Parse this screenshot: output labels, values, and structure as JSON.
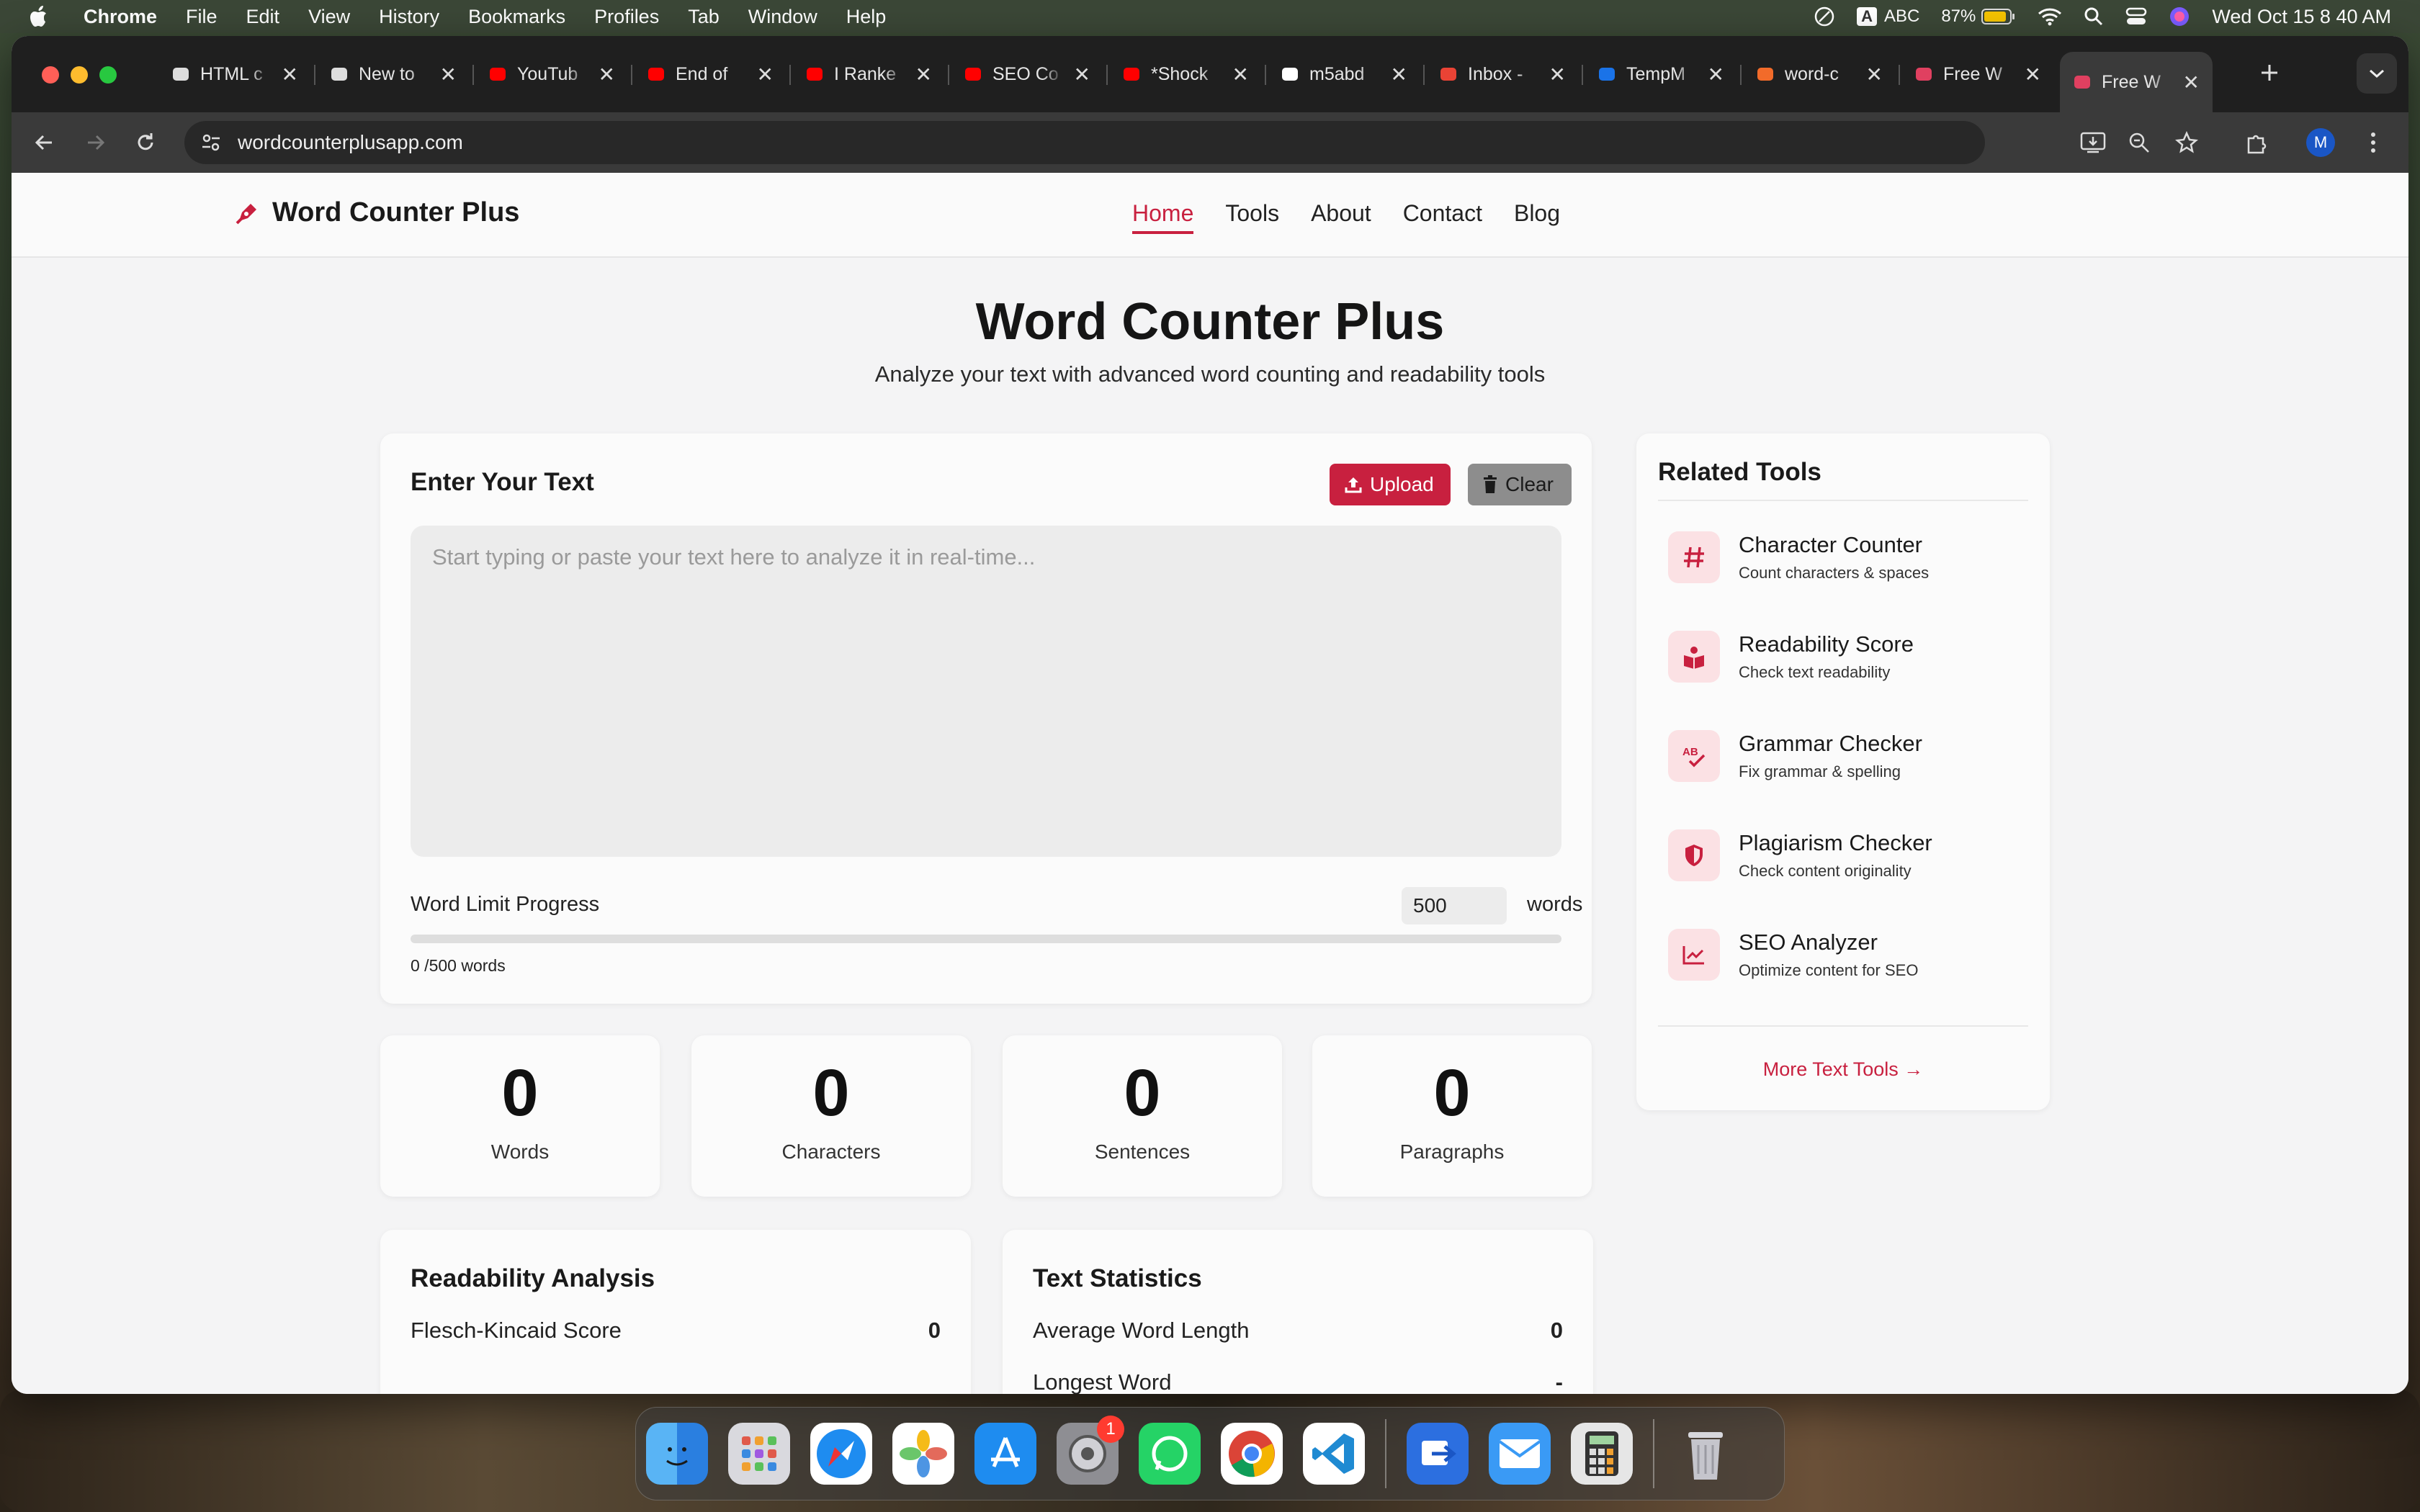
{
  "menubar": {
    "app": "Chrome",
    "items": [
      "File",
      "Edit",
      "View",
      "History",
      "Bookmarks",
      "Profiles",
      "Tab",
      "Window",
      "Help"
    ],
    "input_source": "ABC",
    "input_letter": "A",
    "battery": "87%",
    "datetime": "Wed Oct 15  8 40 AM"
  },
  "tabs": [
    {
      "title": "HTML c",
      "icon": "openai-icon"
    },
    {
      "title": "New to",
      "icon": "openai-icon"
    },
    {
      "title": "YouTub",
      "icon": "youtube-icon"
    },
    {
      "title": "End of",
      "icon": "youtube-icon"
    },
    {
      "title": "I Ranke",
      "icon": "youtube-icon"
    },
    {
      "title": "SEO Co",
      "icon": "youtube-icon"
    },
    {
      "title": "*Shock",
      "icon": "youtube-icon"
    },
    {
      "title": "m5abd",
      "icon": "github-icon"
    },
    {
      "title": "Inbox -",
      "icon": "gmail-icon"
    },
    {
      "title": "TempM",
      "icon": "tempmail-icon"
    },
    {
      "title": "word-c",
      "icon": "grid-icon"
    },
    {
      "title": "Free W",
      "icon": "pen-icon"
    },
    {
      "title": "Free W",
      "icon": "pen-icon",
      "active": true
    }
  ],
  "address": {
    "url": "wordcounterplusapp.com",
    "profile_initial": "M"
  },
  "site": {
    "brand": "Word Counter Plus",
    "nav": [
      "Home",
      "Tools",
      "About",
      "Contact",
      "Blog"
    ],
    "active_nav": "Home",
    "accent": "#c8203f"
  },
  "hero": {
    "title": "Word Counter Plus",
    "subtitle": "Analyze your text with advanced word counting and readability tools"
  },
  "editor": {
    "heading": "Enter Your Text",
    "upload_label": "Upload",
    "clear_label": "Clear",
    "placeholder": "Start typing or paste your text here to analyze it in real-time...",
    "limit_label": "Word Limit Progress",
    "limit_value": "500",
    "limit_unit": "words",
    "progress_text": "0 /500 words",
    "progress_fraction": 0
  },
  "stats": [
    {
      "value": "0",
      "label": "Words"
    },
    {
      "value": "0",
      "label": "Characters"
    },
    {
      "value": "0",
      "label": "Sentences"
    },
    {
      "value": "0",
      "label": "Paragraphs"
    }
  ],
  "related": {
    "heading": "Related Tools",
    "items": [
      {
        "name": "Character Counter",
        "desc": "Count characters & spaces",
        "icon": "hash-icon"
      },
      {
        "name": "Readability Score",
        "desc": "Check text readability",
        "icon": "book-icon"
      },
      {
        "name": "Grammar Checker",
        "desc": "Fix grammar & spelling",
        "icon": "spellcheck-icon"
      },
      {
        "name": "Plagiarism Checker",
        "desc": "Check content originality",
        "icon": "shield-icon"
      },
      {
        "name": "SEO Analyzer",
        "desc": "Optimize content for SEO",
        "icon": "chart-line-icon"
      }
    ],
    "more": "More Text Tools →"
  },
  "readability": {
    "heading": "Readability Analysis",
    "rows": [
      {
        "label": "Flesch-Kincaid Score",
        "value": "0"
      }
    ]
  },
  "textstats": {
    "heading": "Text Statistics",
    "rows": [
      {
        "label": "Average Word Length",
        "value": "0"
      },
      {
        "label": "Longest Word",
        "value": "-"
      }
    ]
  },
  "dock": {
    "apps": [
      "Finder",
      "Launchpad",
      "Safari",
      "Photos",
      "App Store",
      "System Settings",
      "WhatsApp",
      "Chrome",
      "VS Code",
      "Migration",
      "Mail",
      "Calculator",
      "Trash"
    ],
    "settings_badge": "1"
  }
}
